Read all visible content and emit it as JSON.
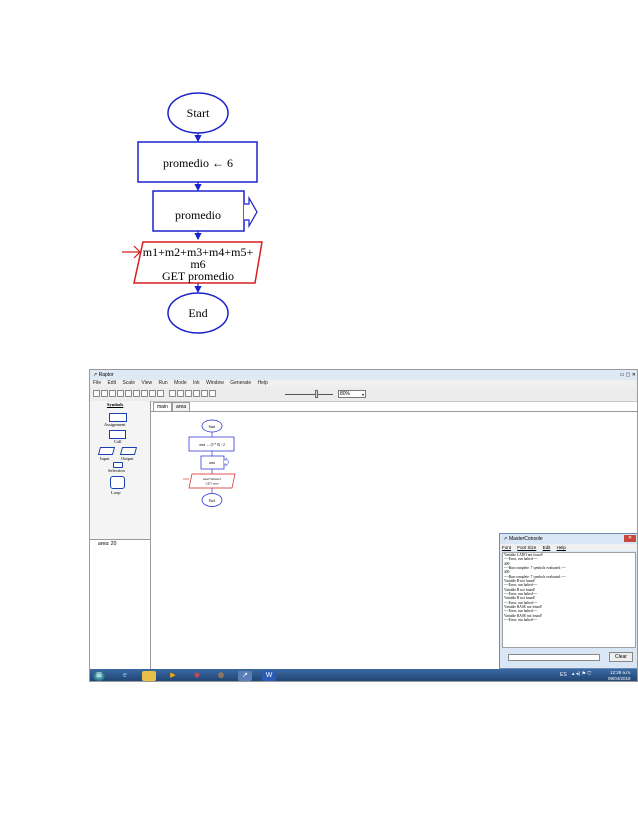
{
  "flowchart": {
    "start": "Start",
    "assign": "promedio ← 6",
    "output": "promedio",
    "input_line1": "m1+m2+m3+m4+m5+",
    "input_line2": "m6",
    "input_line3": "GET promedio",
    "end": "End",
    "colors": {
      "terminal": "#1a22cc",
      "box": "#1a22cc",
      "input": "#d61f1f",
      "arrow": "#d61f1f"
    }
  },
  "raptor": {
    "window_title": "Raptor",
    "menu": [
      "File",
      "Edit",
      "Scale",
      "View",
      "Run",
      "Mode",
      "Ink",
      "Window",
      "Generate",
      "Help"
    ],
    "zoom": "80%",
    "symbols_title": "Symbols",
    "symbols": {
      "assignment": "Assignment",
      "call": "Call",
      "input": "Input",
      "output": "Output",
      "selection": "Selection",
      "loop": "Loop"
    },
    "variables": [
      "area: 20"
    ],
    "tabs": [
      "main",
      "area"
    ],
    "mini_flow": {
      "start": "Start",
      "assign": "area ← (5 * 8) / 2",
      "output": "area",
      "input_line1": "base*altura/2",
      "input_line2": "GET area",
      "end": "End"
    }
  },
  "console": {
    "title": "MasterConsole",
    "menu": [
      "Font",
      "Font Size",
      "Edit",
      "Help"
    ],
    "lines": [
      "Variable LADO not found!",
      "----Error, run halted----",
      "400",
      "----Run complete.  7 symbols evaluated.----",
      "400",
      "----Run complete.  7 symbols evaluated.----",
      "Variable B not found!",
      "----Error, run halted----",
      "Variable B not found!",
      "----Error, run halted----",
      "Variable B not found!",
      "----Error, run halted----",
      "Variable BASE not found!",
      "----Error, run halted----",
      "Variable BASE not found!",
      "----Error, run halted----"
    ],
    "clear_label": "Clear"
  },
  "taskbar": {
    "time": "12:28 a.m.",
    "date": "09/04/2018",
    "lang": "ES"
  }
}
